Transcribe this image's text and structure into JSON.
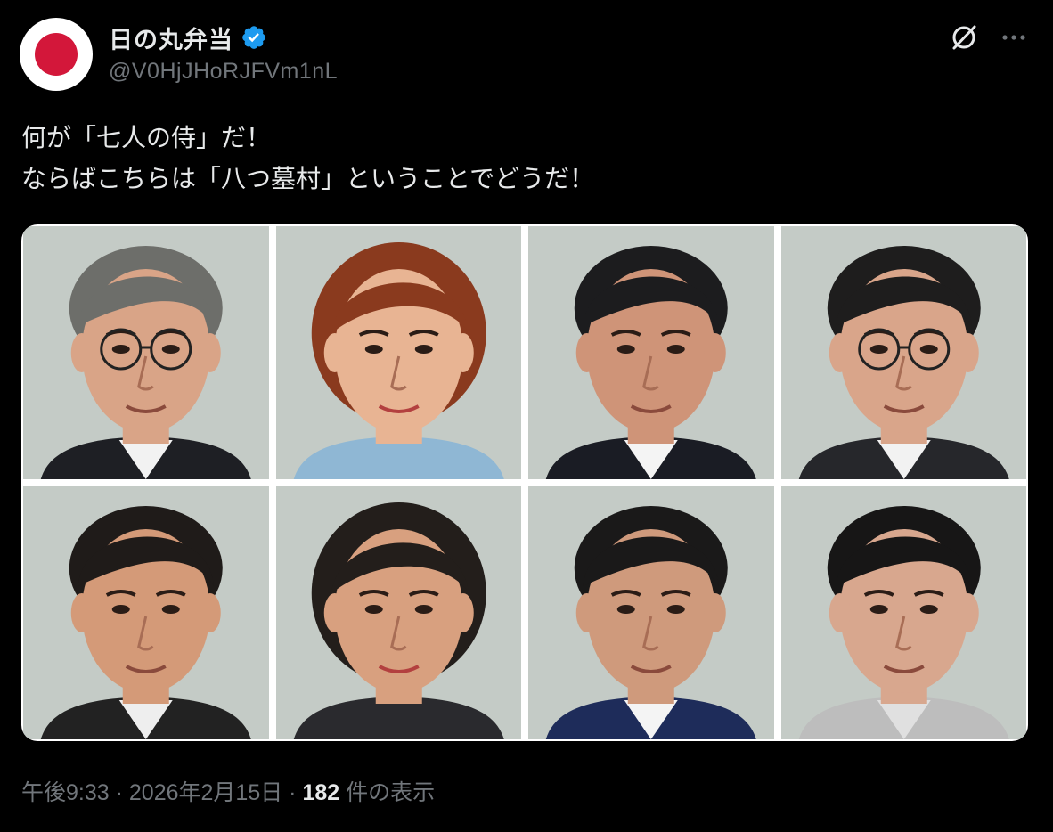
{
  "author": {
    "display_name": "日の丸弁当",
    "handle": "@V0HjJHoRJFVm1nL",
    "avatar_icon": "rising-sun-flag-avatar",
    "verified_icon": "verified-badge-icon",
    "verified_color": "#1d9bf0"
  },
  "actions": {
    "grok_icon": "grok-icon",
    "more_icon": "more-horizontal-icon",
    "more_label": "···"
  },
  "post": {
    "lines": [
      "何が「七人の侍」だ！",
      "ならばこちらは「八つ墓村」ということでどうだ！"
    ]
  },
  "media": {
    "type": "photo-grid",
    "portraits": [
      {
        "kind": "man-glasses-gray-hair"
      },
      {
        "kind": "woman-red-hair"
      },
      {
        "kind": "man-dark-hair"
      },
      {
        "kind": "man-glasses-dark-hair"
      },
      {
        "kind": "man-short-dark-hair"
      },
      {
        "kind": "woman-short-dark-hair"
      },
      {
        "kind": "man-dark-hair-suit"
      },
      {
        "kind": "elderly-man-dark-hair"
      }
    ]
  },
  "meta": {
    "time": "午後9:33",
    "separator": " · ",
    "date": "2026年2月15日",
    "views_count": "182",
    "views_label": " 件の表示"
  },
  "colors": {
    "background": "#000000",
    "text_primary": "#e7e9ea",
    "text_secondary": "#71767b",
    "photo_backdrop": "#c4cbc6"
  }
}
